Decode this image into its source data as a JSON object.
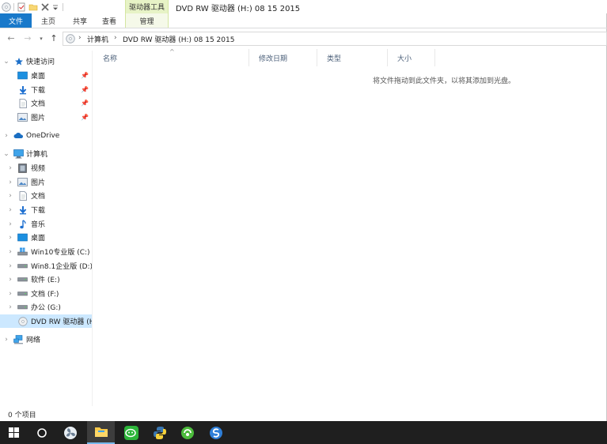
{
  "titlebar": {
    "context_tab_group": "驱动器工具",
    "window_title": "DVD RW 驱动器 (H:) 08 15 2015",
    "qat_icons": [
      "disc-icon",
      "properties-icon",
      "new-folder-icon",
      "delete-icon",
      "customize-qat-icon"
    ]
  },
  "ribbon": {
    "tabs": {
      "file": "文件",
      "home": "主页",
      "share": "共享",
      "view": "查看",
      "manage": "管理"
    }
  },
  "address": {
    "crumbs": [
      "计算机",
      "DVD RW 驱动器 (H:) 08 15 2015"
    ],
    "sep": "›"
  },
  "nav": {
    "quick_access": "快速访问",
    "desktop": "桌面",
    "downloads": "下载",
    "documents": "文档",
    "pictures": "图片",
    "onedrive": "OneDrive",
    "computer": "计算机",
    "videos": "视频",
    "pictures2": "图片",
    "documents2": "文档",
    "downloads2": "下载",
    "music": "音乐",
    "desktop2": "桌面",
    "drive_c": "Win10专业版 (C:)",
    "drive_d": "Win8.1企业版 (D:)",
    "drive_e": "软件 (E:)",
    "drive_f": "文档 (F:)",
    "drive_g": "办公 (G:)",
    "drive_h": "DVD RW 驱动器 (H:",
    "network": "网络"
  },
  "columns": {
    "name": "名称",
    "modified": "修改日期",
    "type": "类型",
    "size": "大小"
  },
  "empty_message": "将文件拖动到此文件夹，以将其添加到光盘。",
  "status": {
    "item_count": "0 个项目"
  },
  "colors": {
    "accent": "#1979ca",
    "selected": "#cce8ff",
    "context_tab": "#e7f3c6",
    "taskbar": "#1f1f1f"
  },
  "taskbar": [
    "windows-start-icon",
    "cortana-icon",
    "fan-app-icon",
    "file-explorer-icon",
    "wechat-icon",
    "python-icon",
    "green-app-icon",
    "blue-app-icon"
  ]
}
